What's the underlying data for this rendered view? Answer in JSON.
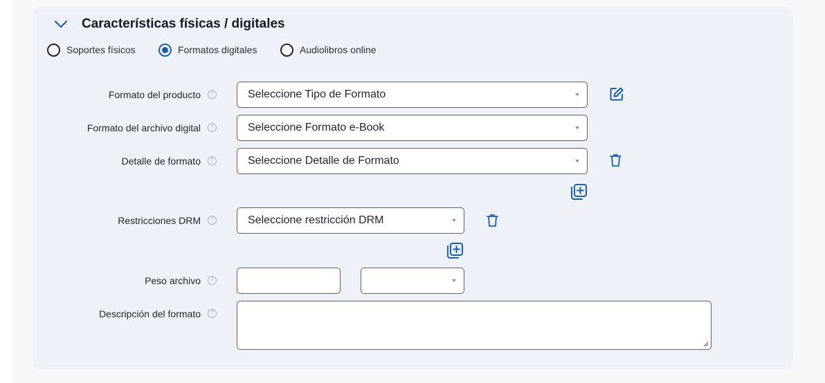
{
  "section": {
    "title": "Características físicas / digitales"
  },
  "radios": [
    {
      "label": "Soportes físicos",
      "selected": false
    },
    {
      "label": "Formatos digitales",
      "selected": true
    },
    {
      "label": "Audiolibros online",
      "selected": false
    }
  ],
  "fields": {
    "formato_producto": {
      "label": "Formato del producto",
      "value": "Seleccione Tipo de Formato"
    },
    "formato_archivo": {
      "label": "Formato del archivo digital",
      "value": "Seleccione Formato e-Book"
    },
    "detalle_formato": {
      "label": "Detalle de formato",
      "value": "Seleccione Detalle de Formato"
    },
    "restricciones_drm": {
      "label": "Restricciones DRM",
      "value": "Seleccione restricción DRM"
    },
    "peso_archivo": {
      "label": "Peso archivo",
      "value": "",
      "unit_value": ""
    },
    "descripcion_formato": {
      "label": "Descripción del formato",
      "value": ""
    }
  },
  "help_glyph": "?",
  "colors": {
    "accent": "#1a5fa6",
    "card_bg": "#eef1f7",
    "border": "#5a5f69"
  },
  "icons": [
    "chevron-down-icon",
    "help-icon",
    "edit-icon",
    "trash-icon",
    "add-copy-icon"
  ]
}
